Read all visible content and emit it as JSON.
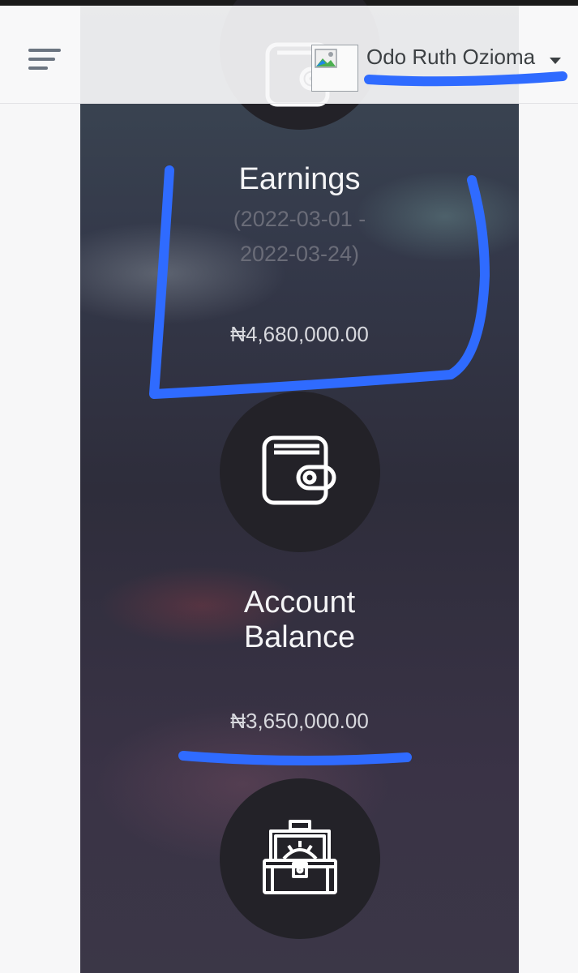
{
  "header": {
    "user_name": "Odo Ruth Ozioma",
    "menu_icon": "hamburger-menu-icon",
    "avatar_icon": "broken-image-icon"
  },
  "cards": [
    {
      "icon": "wallet-icon",
      "title": "Earnings",
      "date_range_line1": "(2022-03-01 -",
      "date_range_line2": "2022-03-24)",
      "amount": "₦4,680,000.00"
    },
    {
      "icon": "wallet-icon",
      "title_line1": "Account",
      "title_line2": "Balance",
      "amount": "₦3,650,000.00"
    },
    {
      "icon": "treasure-chest-icon"
    }
  ],
  "colors": {
    "annotation_blue": "#2f6bff",
    "circle_bg": "#232228",
    "page_bg": "#f7f7f8"
  }
}
